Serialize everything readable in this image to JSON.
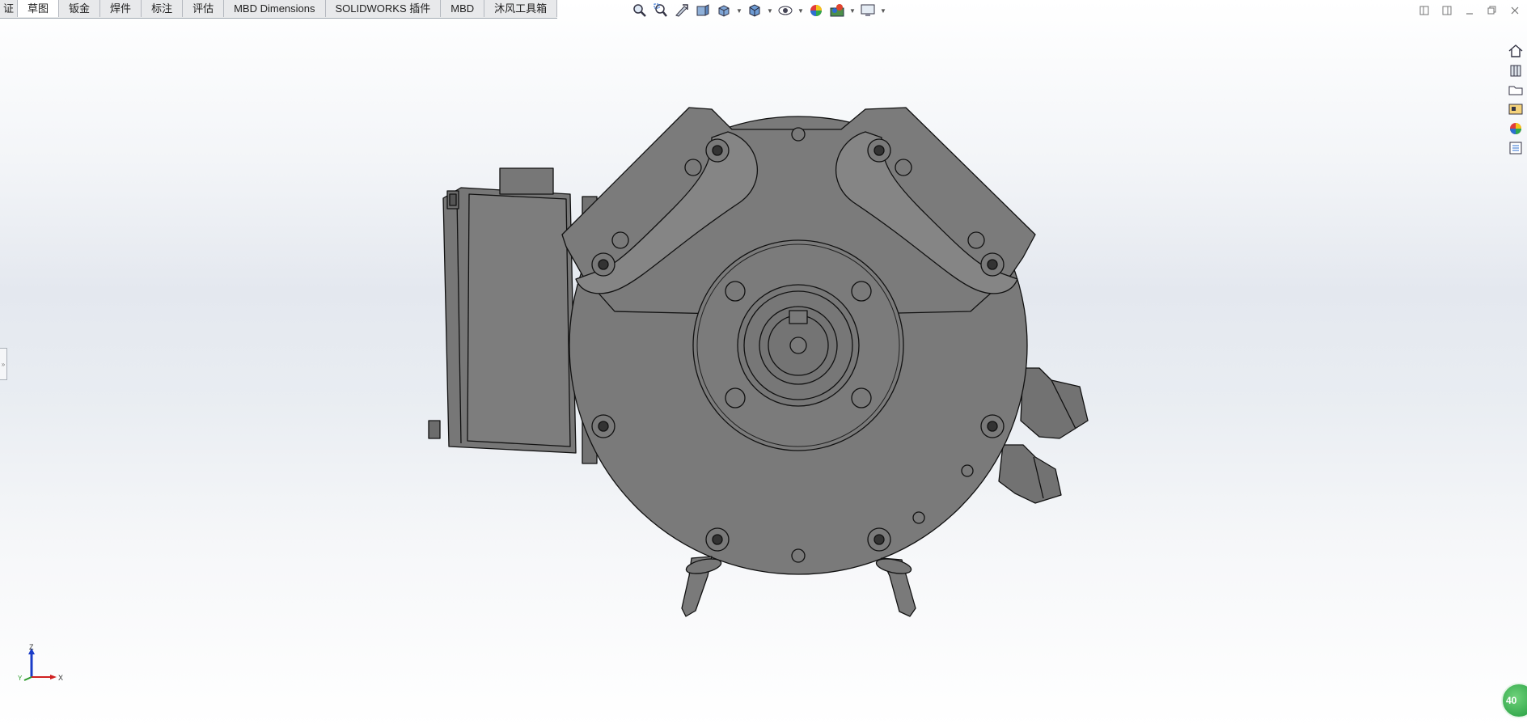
{
  "tabs": [
    {
      "label": "证",
      "active": false
    },
    {
      "label": "草图",
      "active": true
    },
    {
      "label": "钣金",
      "active": false
    },
    {
      "label": "焊件",
      "active": false
    },
    {
      "label": "标注",
      "active": false
    },
    {
      "label": "评估",
      "active": false
    },
    {
      "label": "MBD Dimensions",
      "active": false
    },
    {
      "label": "SOLIDWORKS 插件",
      "active": false
    },
    {
      "label": "MBD",
      "active": false
    },
    {
      "label": "沐风工具箱",
      "active": false
    }
  ],
  "heads_up_toolbar": [
    "zoom-to-fit-icon",
    "zoom-to-area-icon",
    "previous-view-icon",
    "section-view-icon",
    "view-orientation-icon",
    "display-style-icon",
    "hide-show-items-icon",
    "edit-appearance-icon",
    "apply-scene-icon",
    "view-settings-icon"
  ],
  "task_pane": [
    "solidworks-resources-icon",
    "design-library-icon",
    "file-explorer-icon",
    "view-palette-icon",
    "appearances-icon",
    "custom-properties-icon"
  ],
  "triad": {
    "z_label": "Z",
    "x_label": "X",
    "y_label": "Y"
  },
  "status_badge": {
    "text": "40"
  },
  "colors": {
    "body": "#7a7a7a",
    "edge": "#111111",
    "axis_z": "#1a3cc8",
    "axis_x": "#d02020",
    "axis_y": "#2a9a2a"
  }
}
